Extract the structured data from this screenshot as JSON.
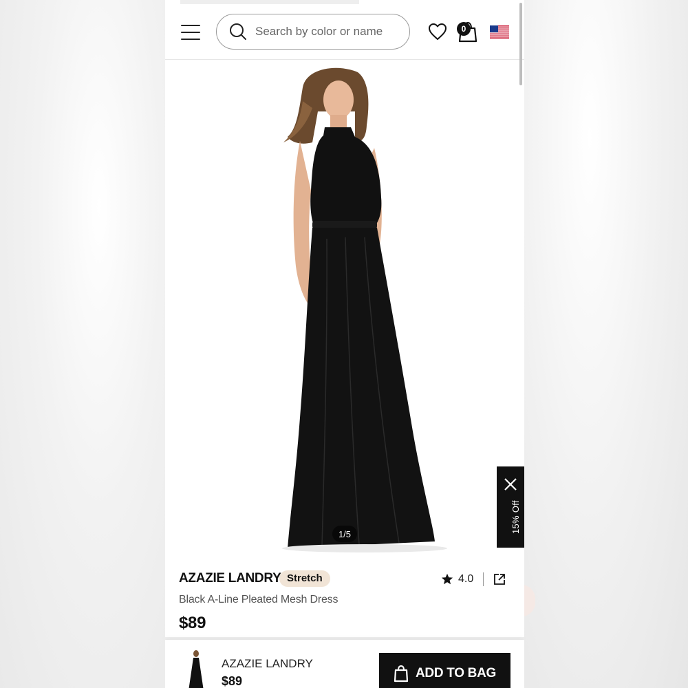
{
  "header": {
    "search_placeholder": "Search by color or name",
    "cart_count": "0",
    "icons": [
      "menu-icon",
      "search-icon",
      "heart-icon",
      "bag-icon",
      "us-flag-icon"
    ]
  },
  "gallery": {
    "counter": "1/5"
  },
  "promo": {
    "label": "15% Off",
    "close_icon": "close-icon"
  },
  "product": {
    "brand": "AZAZIE LANDRY",
    "badge": "Stretch",
    "rating": "4.0",
    "title": "Black A-Line Pleated Mesh Dress",
    "price": "$89"
  },
  "sticky_bar": {
    "brand": "AZAZIE LANDRY",
    "price": "$89",
    "button_label": "ADD TO BAG"
  },
  "colors": {
    "accent": "#111111",
    "badge_bg": "#f1e4d6"
  }
}
